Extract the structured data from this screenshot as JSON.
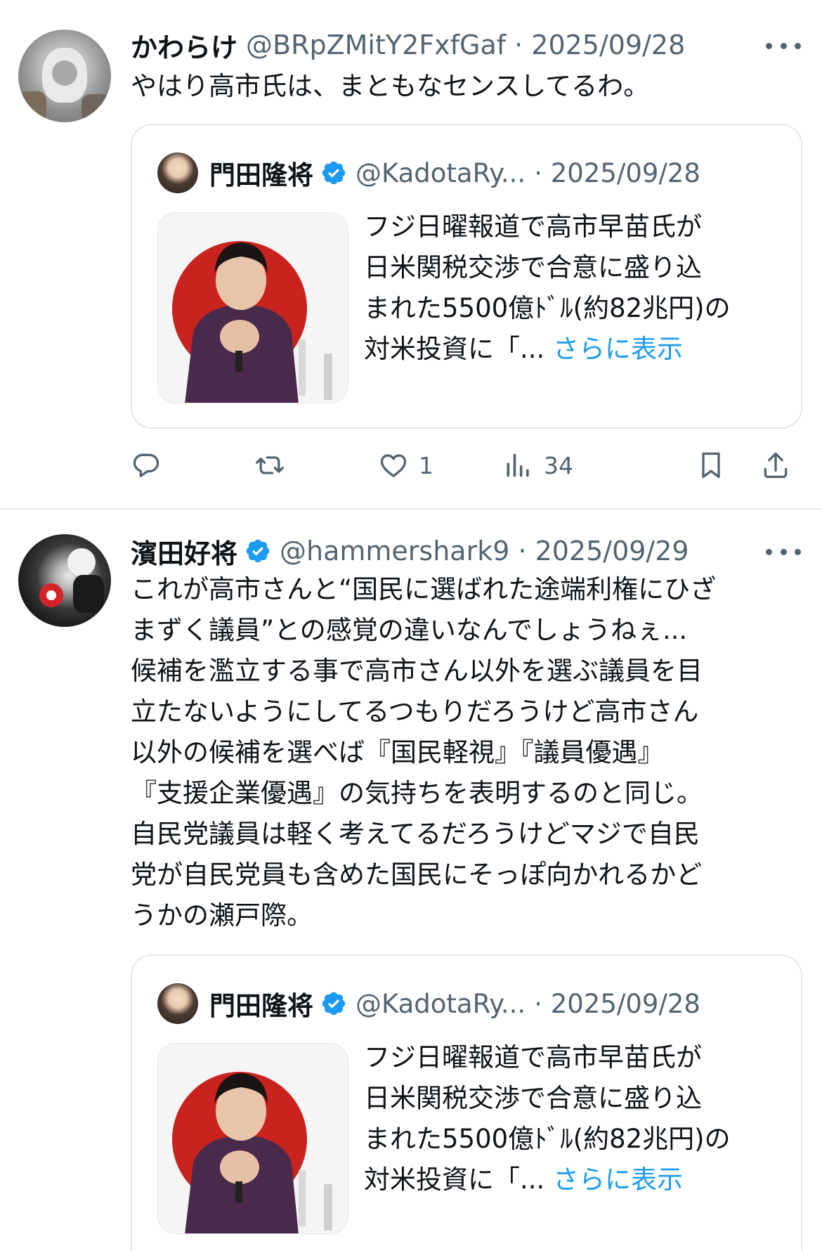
{
  "tweets": [
    {
      "author": "かわらけ",
      "handle": "@BRpZMitY2FxfGaf",
      "date": "· 2025/09/28",
      "text": "やはり高市氏は、まともなセンスしてるわ。",
      "quote": {
        "author": "門田隆将",
        "handle": "@KadotaRy...",
        "date": "· 2025/09/28",
        "text": "フジ日曜報道で高市早苗氏が\n日米関税交渉で合意に盛り込\nまれた5500億ﾄﾞﾙ(約82兆円)の\n対米投資に「... ",
        "more_label": "さらに表示"
      },
      "likes": "1",
      "views": "34"
    },
    {
      "author": "濱田好将",
      "handle": "@hammershark9",
      "date": "· 2025/09/29",
      "text": "これが高市さんと“国民に選ばれた途端利権にひざ\nまずく議員”との感覚の違いなんでしょうねぇ...\n候補を濫立する事で高市さん以外を選ぶ議員を目\n立たないようにしてるつもりだろうけど高市さん\n以外の候補を選べば『国民軽視』『議員優遇』\n『支援企業優遇』の気持ちを表明するのと同じ。\n自民党議員は軽く考えてるだろうけどマジで自民\n党が自民党員も含めた国民にそっぽ向かれるかど\nうかの瀬戸際。",
      "quote": {
        "author": "門田隆将",
        "handle": "@KadotaRy...",
        "date": "· 2025/09/28",
        "text": "フジ日曜報道で高市早苗氏が\n日米関税交渉で合意に盛り込\nまれた5500億ﾄﾞﾙ(約82兆円)の\n対米投資に「... ",
        "more_label": "さらに表示"
      }
    }
  ],
  "colors": {
    "accent": "#1d9bf0",
    "muted": "#536471",
    "border": "#e1e8ed"
  },
  "icons": [
    "reply-icon",
    "retweet-icon",
    "like-icon",
    "views-icon",
    "bookmark-icon",
    "share-icon",
    "verified-badge-icon",
    "more-icon"
  ]
}
